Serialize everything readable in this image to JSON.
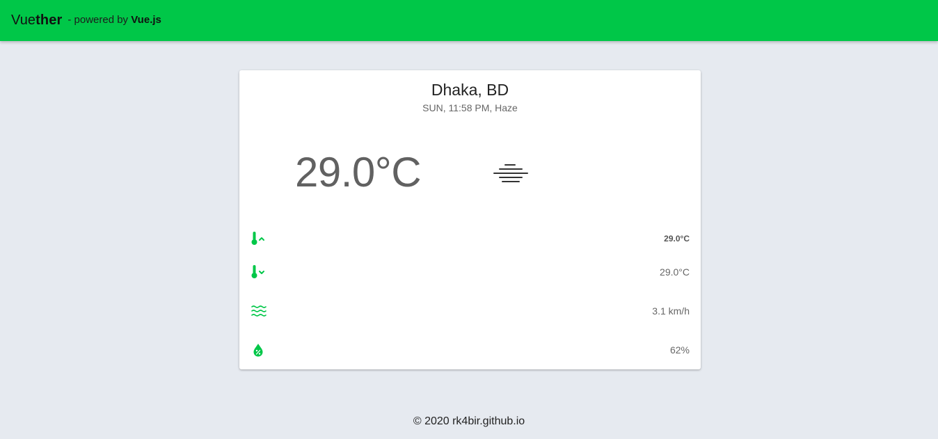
{
  "header": {
    "brand_light": "Vue",
    "brand_bold": "ther",
    "powered_prefix": "- powered by ",
    "powered_name": "Vue.js",
    "accent_color": "#00c748"
  },
  "weather": {
    "location": "Dhaka, BD",
    "subtitle": "SUN, 11:58 PM, Haze",
    "temperature": "29.0°C",
    "condition_icon": "haze-icon",
    "details": [
      {
        "icon": "thermometer-high-icon",
        "value": "29.0°C"
      },
      {
        "icon": "thermometer-low-icon",
        "value": "29.0°C"
      },
      {
        "icon": "wind-waves-icon",
        "value": "3.1 km/h"
      },
      {
        "icon": "humidity-drop-icon",
        "value": "62%"
      }
    ]
  },
  "footer": {
    "text": "© 2020 rk4bir.github.io"
  }
}
